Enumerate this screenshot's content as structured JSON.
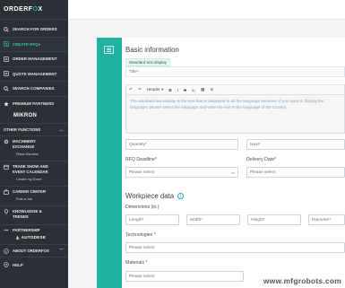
{
  "logo": {
    "text_pre": "ORDERF",
    "text_o": "O",
    "text_post": "X"
  },
  "sidebar": {
    "items": [
      {
        "label": "SEARCH FOR ORDERS",
        "icon": "search-icon"
      },
      {
        "label": "CREATE RFQs",
        "icon": "plus-icon",
        "active": true
      },
      {
        "label": "ORDER MANAGEMENT",
        "icon": "list-icon"
      },
      {
        "label": "QUOTE MANAGEMENT",
        "icon": "list-icon"
      },
      {
        "label": "SEARCH COMPANIES",
        "icon": "search-icon"
      },
      {
        "label": "PREMIUM PARTNERS",
        "icon": "star-icon"
      }
    ],
    "premium_partner": "MIKRON",
    "other_functions": "OTHER FUNCTIONS",
    "groups": [
      {
        "title": "MACHINERY EXCHANGE",
        "sub": "Place Machine"
      },
      {
        "title": "TRADE SHOW AND EVENT CALENDAR",
        "sub": "Create my Event"
      },
      {
        "title": "CAREER CENTER",
        "sub": "Post a Job"
      },
      {
        "title": "KNOWLEDGE & TRENDS",
        "sub": ""
      }
    ],
    "partnership": "PARTNERSHIP",
    "partnership_brand": "AUTODESK",
    "about": "ABOUT ORDERFOX",
    "help": "HELP"
  },
  "form": {
    "basic_info": "Basic information",
    "standard_chip": "Standard text display",
    "title_placeholder": "Title*",
    "toolbar": {
      "undo": "↶",
      "redo": "↷",
      "header": "Header",
      "bold": "B",
      "italic": "I",
      "strike": "S",
      "sub": "x₂",
      "image": "▦",
      "clear": "⊘"
    },
    "editor_text": "The standard text display is the text that is displayed in all the language versions. If you want to display the language, please select the language and write the text in the language of the country.",
    "quantity": "Quantity*",
    "next": "Next*",
    "rfq_deadline_label": "RFQ Deadline*",
    "delivery_date_label": "Delivery Date*",
    "please_select": "Please select",
    "workpiece_title": "Workpiece data",
    "dimensions_label": "Dimensions (in.)",
    "length": "Length*",
    "width": "Width*",
    "height": "Height*",
    "diameter": "Diameter*",
    "technologies_label": "Technologies *",
    "materials_label": "Materials *"
  },
  "watermark": "www.mfgrobots.com",
  "colors": {
    "sidebar_bg": "#2b3037",
    "accent": "#22b3a0",
    "active_text": "#3ec2a8"
  }
}
